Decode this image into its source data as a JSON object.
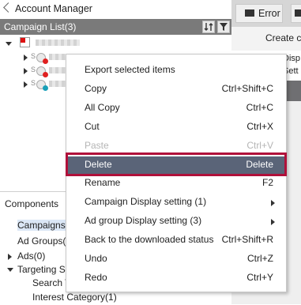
{
  "account_manager": {
    "title": "Account Manager"
  },
  "campaign_list": {
    "title": "Campaign List(3)",
    "campaign_prefix": "S"
  },
  "components": {
    "header": "Components",
    "items": [
      {
        "label": "Campaigns("
      },
      {
        "label": "Ad Groups("
      },
      {
        "label": "Ads(0)"
      },
      {
        "label": "Targeting Se"
      },
      {
        "label": "Search T"
      },
      {
        "label": "Interest Category(1)"
      }
    ]
  },
  "toolbar": {
    "error_label": "Error",
    "create_label": "Create c"
  },
  "grid": {
    "col1": "Disp",
    "col2": "Sett"
  },
  "context_menu": {
    "items": [
      {
        "label": "Export selected items",
        "shortcut": ""
      },
      {
        "label": "Copy",
        "shortcut": "Ctrl+Shift+C"
      },
      {
        "label": "All Copy",
        "shortcut": "Ctrl+C"
      },
      {
        "label": "Cut",
        "shortcut": "Ctrl+X"
      },
      {
        "label": "Paste",
        "shortcut": "Ctrl+V"
      },
      {
        "label": "Delete",
        "shortcut": "Delete"
      },
      {
        "label": "Rename",
        "shortcut": "F2"
      },
      {
        "label": "Campaign Display setting (1)",
        "shortcut": ""
      },
      {
        "label": "Ad group Display setting (3)",
        "shortcut": ""
      },
      {
        "label": "Back to the downloaded status",
        "shortcut": "Ctrl+Shift+R"
      },
      {
        "label": "Undo",
        "shortcut": "Ctrl+Z"
      },
      {
        "label": "Redo",
        "shortcut": "Ctrl+Y"
      }
    ]
  },
  "icons": {
    "back": "chevron-left-icon",
    "sort": "sort-icon",
    "filter": "filter-icon",
    "error": "error-icon",
    "submenu": "chevron-right-icon"
  },
  "colors": {
    "selected_item": "#5a6478",
    "highlight_border": "#b0103a",
    "status_red": "#e02020",
    "status_teal": "#18a0b8"
  }
}
